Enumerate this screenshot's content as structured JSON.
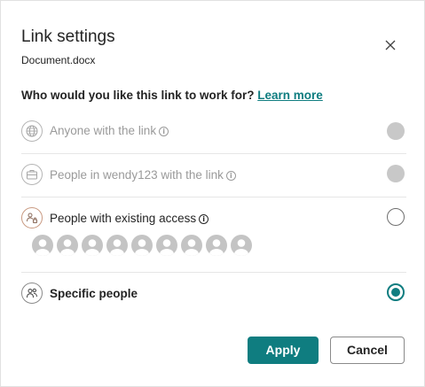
{
  "dialog": {
    "title": "Link settings",
    "subtitle": "Document.docx",
    "close_icon": "close-icon"
  },
  "question": {
    "text": "Who would you like this link to work for? ",
    "learn_more": "Learn more"
  },
  "options": [
    {
      "label": "Anyone with the link",
      "icon": "globe-icon",
      "state": "disabled",
      "info": "i"
    },
    {
      "label": "People in wendy123 with the link",
      "icon": "briefcase-icon",
      "state": "disabled",
      "info": "i"
    },
    {
      "label": "People with existing access",
      "icon": "people-lock-icon",
      "state": "unselected",
      "info": "i"
    },
    {
      "label": "Specific people",
      "icon": "people-icon",
      "state": "selected"
    }
  ],
  "existing_access_avatar_count": 9,
  "buttons": {
    "apply": "Apply",
    "cancel": "Cancel"
  },
  "colors": {
    "accent": "#0f7d80",
    "disabled_radio": "#c8c8c8",
    "avatar": "#c4c4c4"
  }
}
